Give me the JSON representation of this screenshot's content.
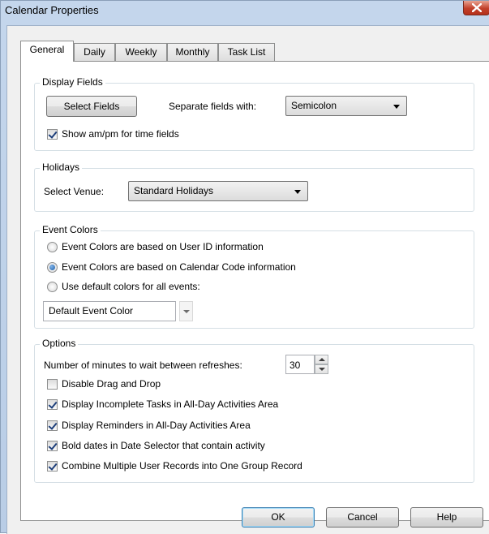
{
  "window": {
    "title": "Calendar Properties"
  },
  "tabs": [
    {
      "label": "General",
      "active": true
    },
    {
      "label": "Daily",
      "active": false
    },
    {
      "label": "Weekly",
      "active": false
    },
    {
      "label": "Monthly",
      "active": false
    },
    {
      "label": "Task List",
      "active": false
    }
  ],
  "display_fields": {
    "title": "Display Fields",
    "select_button": "Select Fields",
    "separate_label": "Separate fields with:",
    "separator_value": "Semicolon",
    "show_ampm_label": "Show am/pm for time fields",
    "show_ampm_checked": true
  },
  "holidays": {
    "title": "Holidays",
    "venue_label": "Select Venue:",
    "venue_value": "Standard Holidays"
  },
  "event_colors": {
    "title": "Event Colors",
    "options": [
      {
        "label": "Event Colors are based on User ID information",
        "selected": false
      },
      {
        "label": "Event Colors are based on Calendar Code information",
        "selected": true
      },
      {
        "label": "Use default colors for all events:",
        "selected": false
      }
    ],
    "default_color_value": "Default Event Color"
  },
  "options": {
    "title": "Options",
    "refresh_label": "Number of minutes to wait between refreshes:",
    "refresh_value": "30",
    "checkboxes": [
      {
        "label": "Disable Drag and Drop",
        "checked": false
      },
      {
        "label": "Display Incomplete Tasks in All-Day Activities Area",
        "checked": true
      },
      {
        "label": "Display Reminders in All-Day Activities Area",
        "checked": true
      },
      {
        "label": "Bold dates in Date Selector that contain activity",
        "checked": true
      },
      {
        "label": "Combine Multiple User Records into One Group Record",
        "checked": true
      }
    ]
  },
  "buttons": {
    "ok": "OK",
    "cancel": "Cancel",
    "help": "Help"
  },
  "icons": {
    "close": "close-icon",
    "dropdown": "chevron-down-icon",
    "spinner_up": "spin-up-icon",
    "spinner_down": "spin-down-icon"
  }
}
